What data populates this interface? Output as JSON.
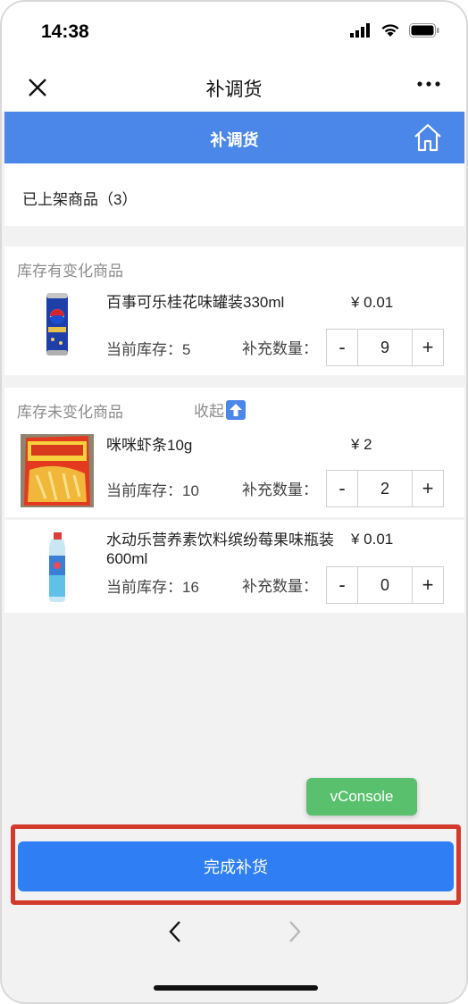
{
  "status": {
    "time": "14:38"
  },
  "nav": {
    "title": "补调货"
  },
  "header": {
    "title": "补调货"
  },
  "shelf": {
    "label": "已上架商品（3）"
  },
  "changed_section": {
    "title": "库存有变化商品",
    "items": [
      {
        "name": "百事可乐桂花味罐装330ml",
        "price": "¥ 0.01",
        "stock_label": "当前库存：",
        "stock": "5",
        "refill_label": "补充数量：",
        "minus": "-",
        "qty": "9",
        "plus": "+"
      }
    ]
  },
  "unchanged_section": {
    "title": "库存未变化商品",
    "collapse_label": "收起",
    "items": [
      {
        "name": "咪咪虾条10g",
        "price": "¥ 2",
        "stock_label": "当前库存：",
        "stock": "10",
        "refill_label": "补充数量：",
        "minus": "-",
        "qty": "2",
        "plus": "+"
      },
      {
        "name": "水动乐营养素饮料缤纷莓果味瓶装600ml",
        "price": "¥ 0.01",
        "stock_label": "当前库存：",
        "stock": "16",
        "refill_label": "补充数量：",
        "minus": "-",
        "qty": "0",
        "plus": "+"
      }
    ]
  },
  "vconsole": {
    "label": "vConsole"
  },
  "footer": {
    "complete_label": "完成补货"
  },
  "colors": {
    "header_blue": "#4b86e9",
    "button_blue": "#2f7ef3",
    "highlight_red": "#d33a2c",
    "vconsole_green": "#59c06e"
  }
}
